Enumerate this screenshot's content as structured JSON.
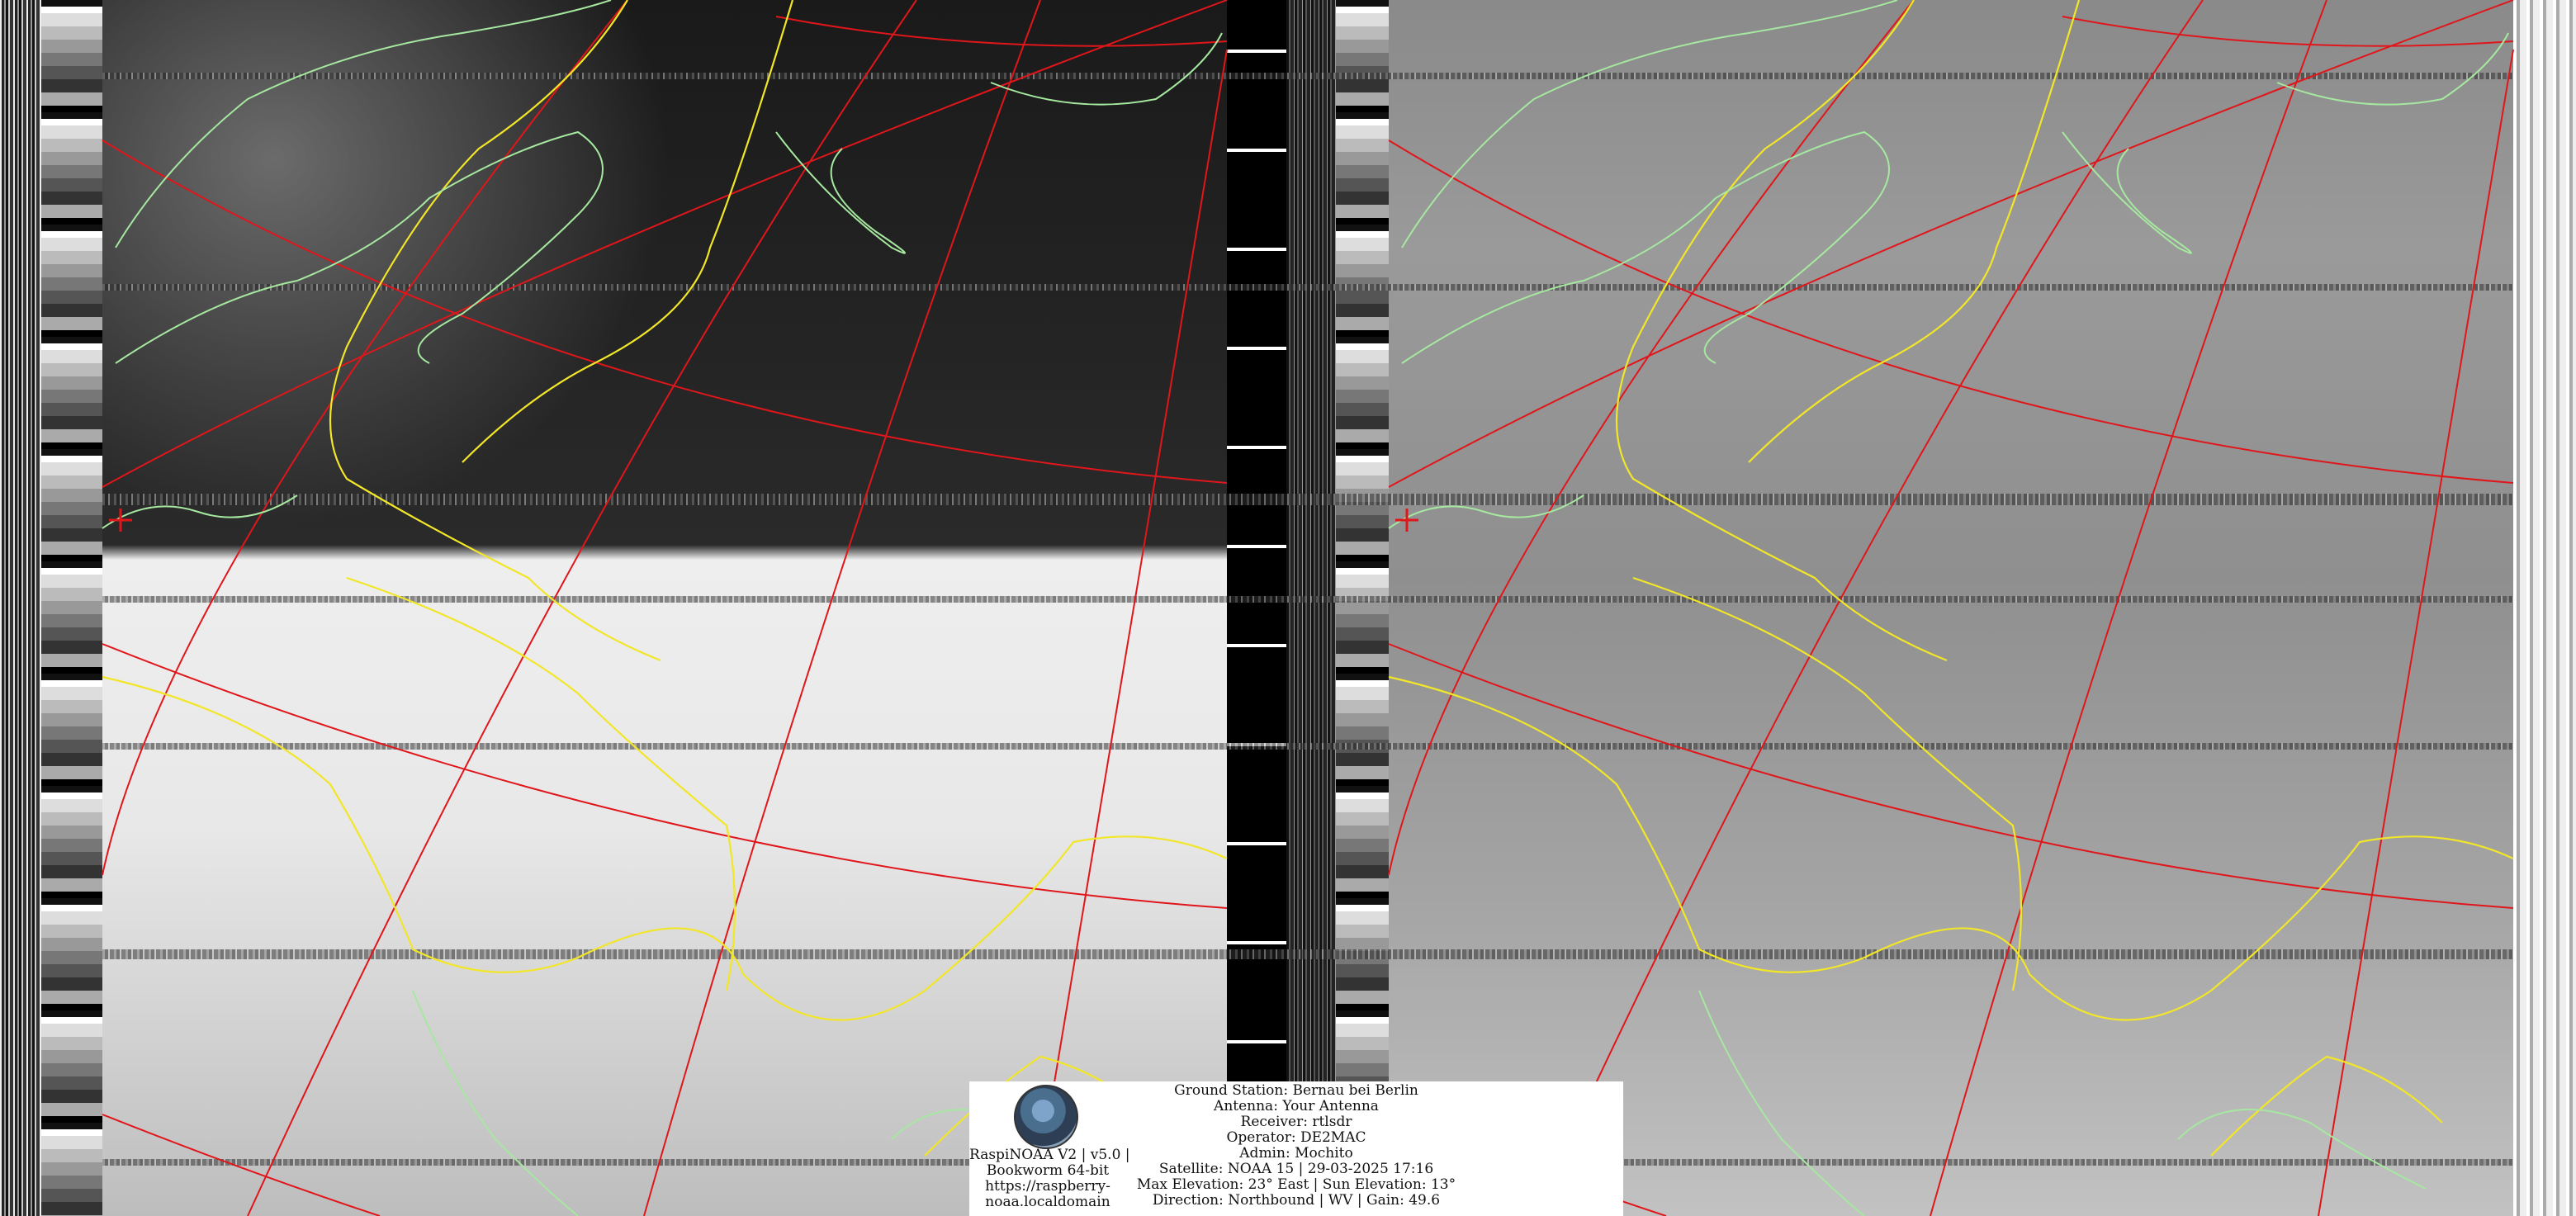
{
  "overlay": {
    "software": "RaspiNOAA V2 | v5.0 |",
    "os": "Bookworm 64-bit",
    "url_line1": "https://raspberry-",
    "url_line2": "noaa.localdomain",
    "ground_station": "Ground Station: Bernau bei Berlin",
    "antenna": "Antenna: Your Antenna",
    "receiver": "Receiver: rtlsdr",
    "operator": "Operator: DE2MAC",
    "admin": "Admin: Mochito",
    "satellite": "Satellite: NOAA 15 | 29-03-2025 17:16",
    "elevation": "Max Elevation: 23° East | Sun Elevation: 13°",
    "direction": "Direction: Northbound | WV | Gain: 49.6"
  },
  "colors": {
    "graticule": "#e0161b",
    "borders": "#f2e628",
    "coastline": "#a6e8a0",
    "sync_marker": "#e0161b"
  }
}
